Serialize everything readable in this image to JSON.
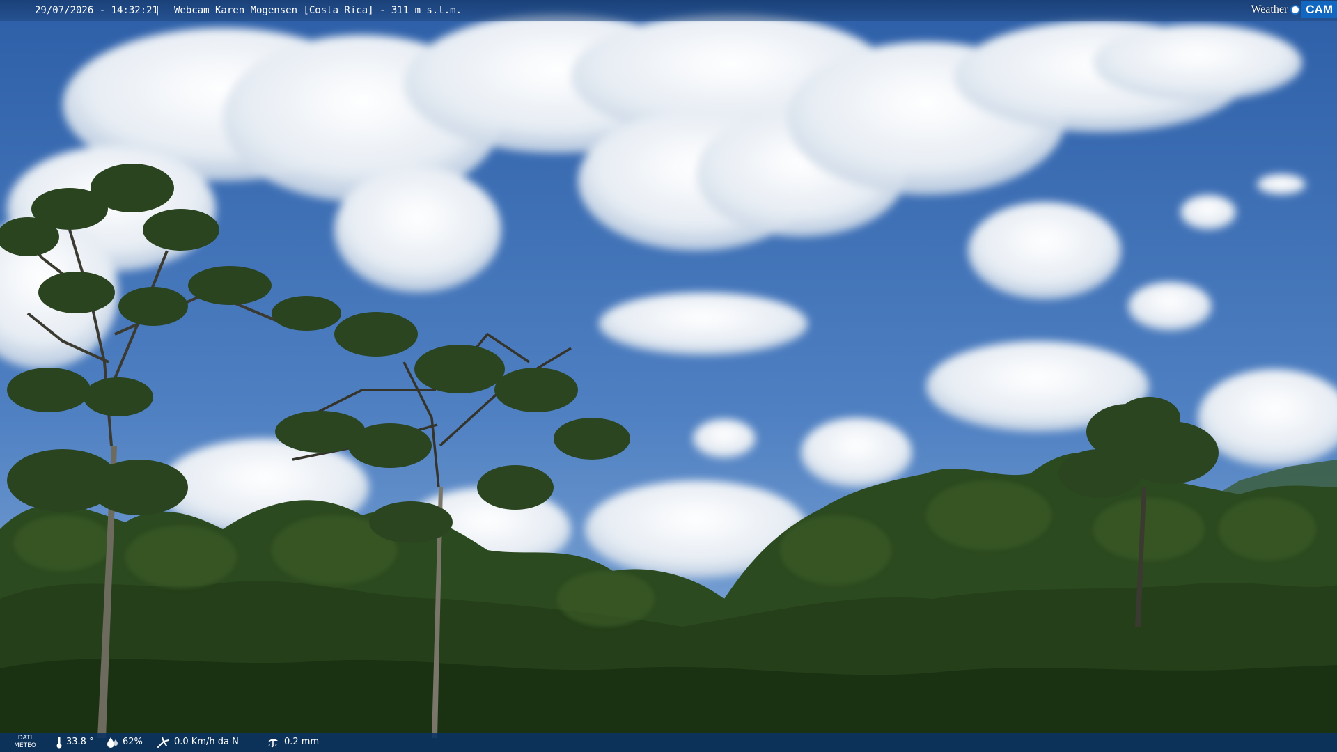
{
  "overlay": {
    "datetime": "29/07/2026 - 14:32:21",
    "separator": "|",
    "title": "Webcam Karen Mogensen [Costa Rica]  - 311 m s.l.m."
  },
  "logo": {
    "weather": "Weather",
    "cam": "CAM"
  },
  "meteo": {
    "label_line1": "DATI",
    "label_line2": "METEO",
    "temperature": "33.8 °",
    "humidity": "62%",
    "wind": "0.0 Km/h da N",
    "rain": "0.2 mm"
  },
  "icons": {
    "temperature": "thermometer-icon",
    "humidity": "humidity-drop-icon",
    "wind": "wind-icon",
    "rain": "rain-icon"
  },
  "colors": {
    "sky_top": "#2d5fa8",
    "sky_bottom": "#7ea8d8",
    "cloud": "#f2f5f8",
    "forest_dark": "#1d3314",
    "forest_mid": "#2e4d20",
    "bar": "#0a3264"
  }
}
